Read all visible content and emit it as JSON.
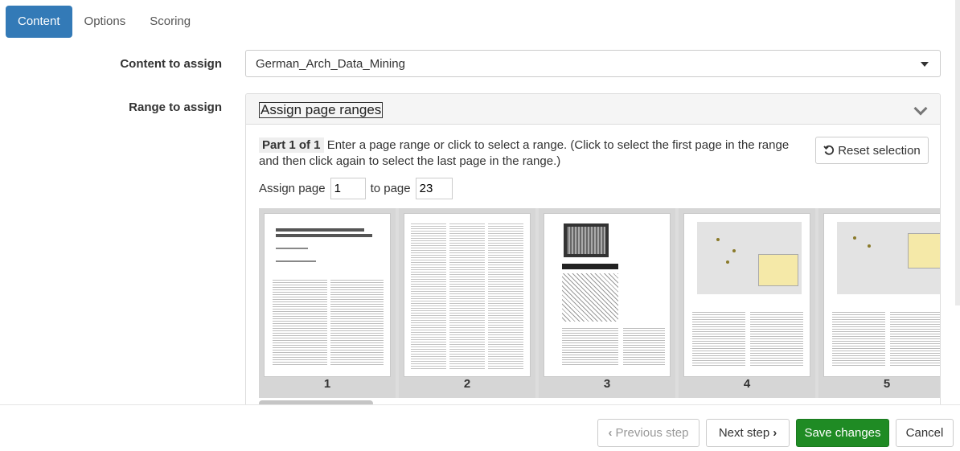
{
  "tabs": [
    {
      "label": "Content",
      "active": true
    },
    {
      "label": "Options",
      "active": false
    },
    {
      "label": "Scoring",
      "active": false
    }
  ],
  "form": {
    "content_label": "Content to assign",
    "content_value": "German_Arch_Data_Mining",
    "range_label": "Range to assign"
  },
  "panel": {
    "title": "Assign page ranges",
    "part": "Part 1 of 1",
    "instructions": "Enter a page range or click to select a range. (Click to select the first page in the range and then click again to select the last page in the range.)",
    "reset_label": "Reset selection",
    "assign_page_label": "Assign page",
    "assign_page_value": "1",
    "to_page_label": "to page",
    "to_page_value": "23"
  },
  "pages": [
    {
      "label": "1",
      "icon": "journal-page-thumbnail"
    },
    {
      "label": "2",
      "icon": "journal-page-thumbnail"
    },
    {
      "label": "3",
      "icon": "journal-page-thumbnail"
    },
    {
      "label": "4",
      "icon": "map-page-thumbnail"
    },
    {
      "label": "5",
      "icon": "map-page-thumbnail"
    }
  ],
  "footer": {
    "prev_label": "Previous step",
    "next_label": "Next step",
    "save_label": "Save changes",
    "cancel_label": "Cancel"
  },
  "colors": {
    "primary": "#337ab7",
    "success": "#1f8b24"
  }
}
